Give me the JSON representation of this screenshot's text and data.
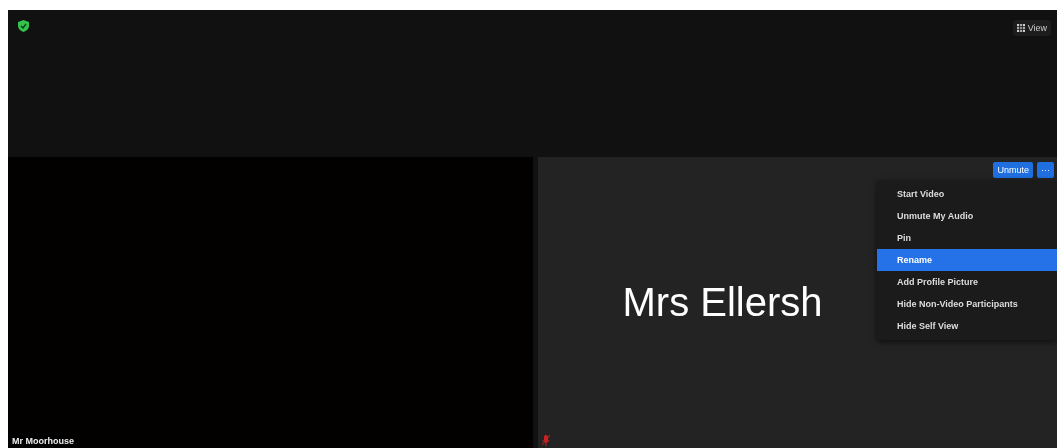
{
  "top_bar": {
    "view_button": {
      "label": "View"
    }
  },
  "tiles": [
    {
      "name": "Mr Moorhouse",
      "kind": "video"
    },
    {
      "name": "Mrs Ellersh",
      "kind": "avatar",
      "muted": true,
      "unmute_button": "Unmute",
      "more_button": "···"
    }
  ],
  "menu": [
    {
      "label": "Start Video",
      "selected": false
    },
    {
      "label": "Unmute My Audio",
      "selected": false
    },
    {
      "label": "Pin",
      "selected": false
    },
    {
      "label": "Rename",
      "selected": true
    },
    {
      "label": "Add Profile Picture",
      "selected": false
    },
    {
      "label": "Hide Non-Video Participants",
      "selected": false
    },
    {
      "label": "Hide Self View",
      "selected": false
    }
  ]
}
